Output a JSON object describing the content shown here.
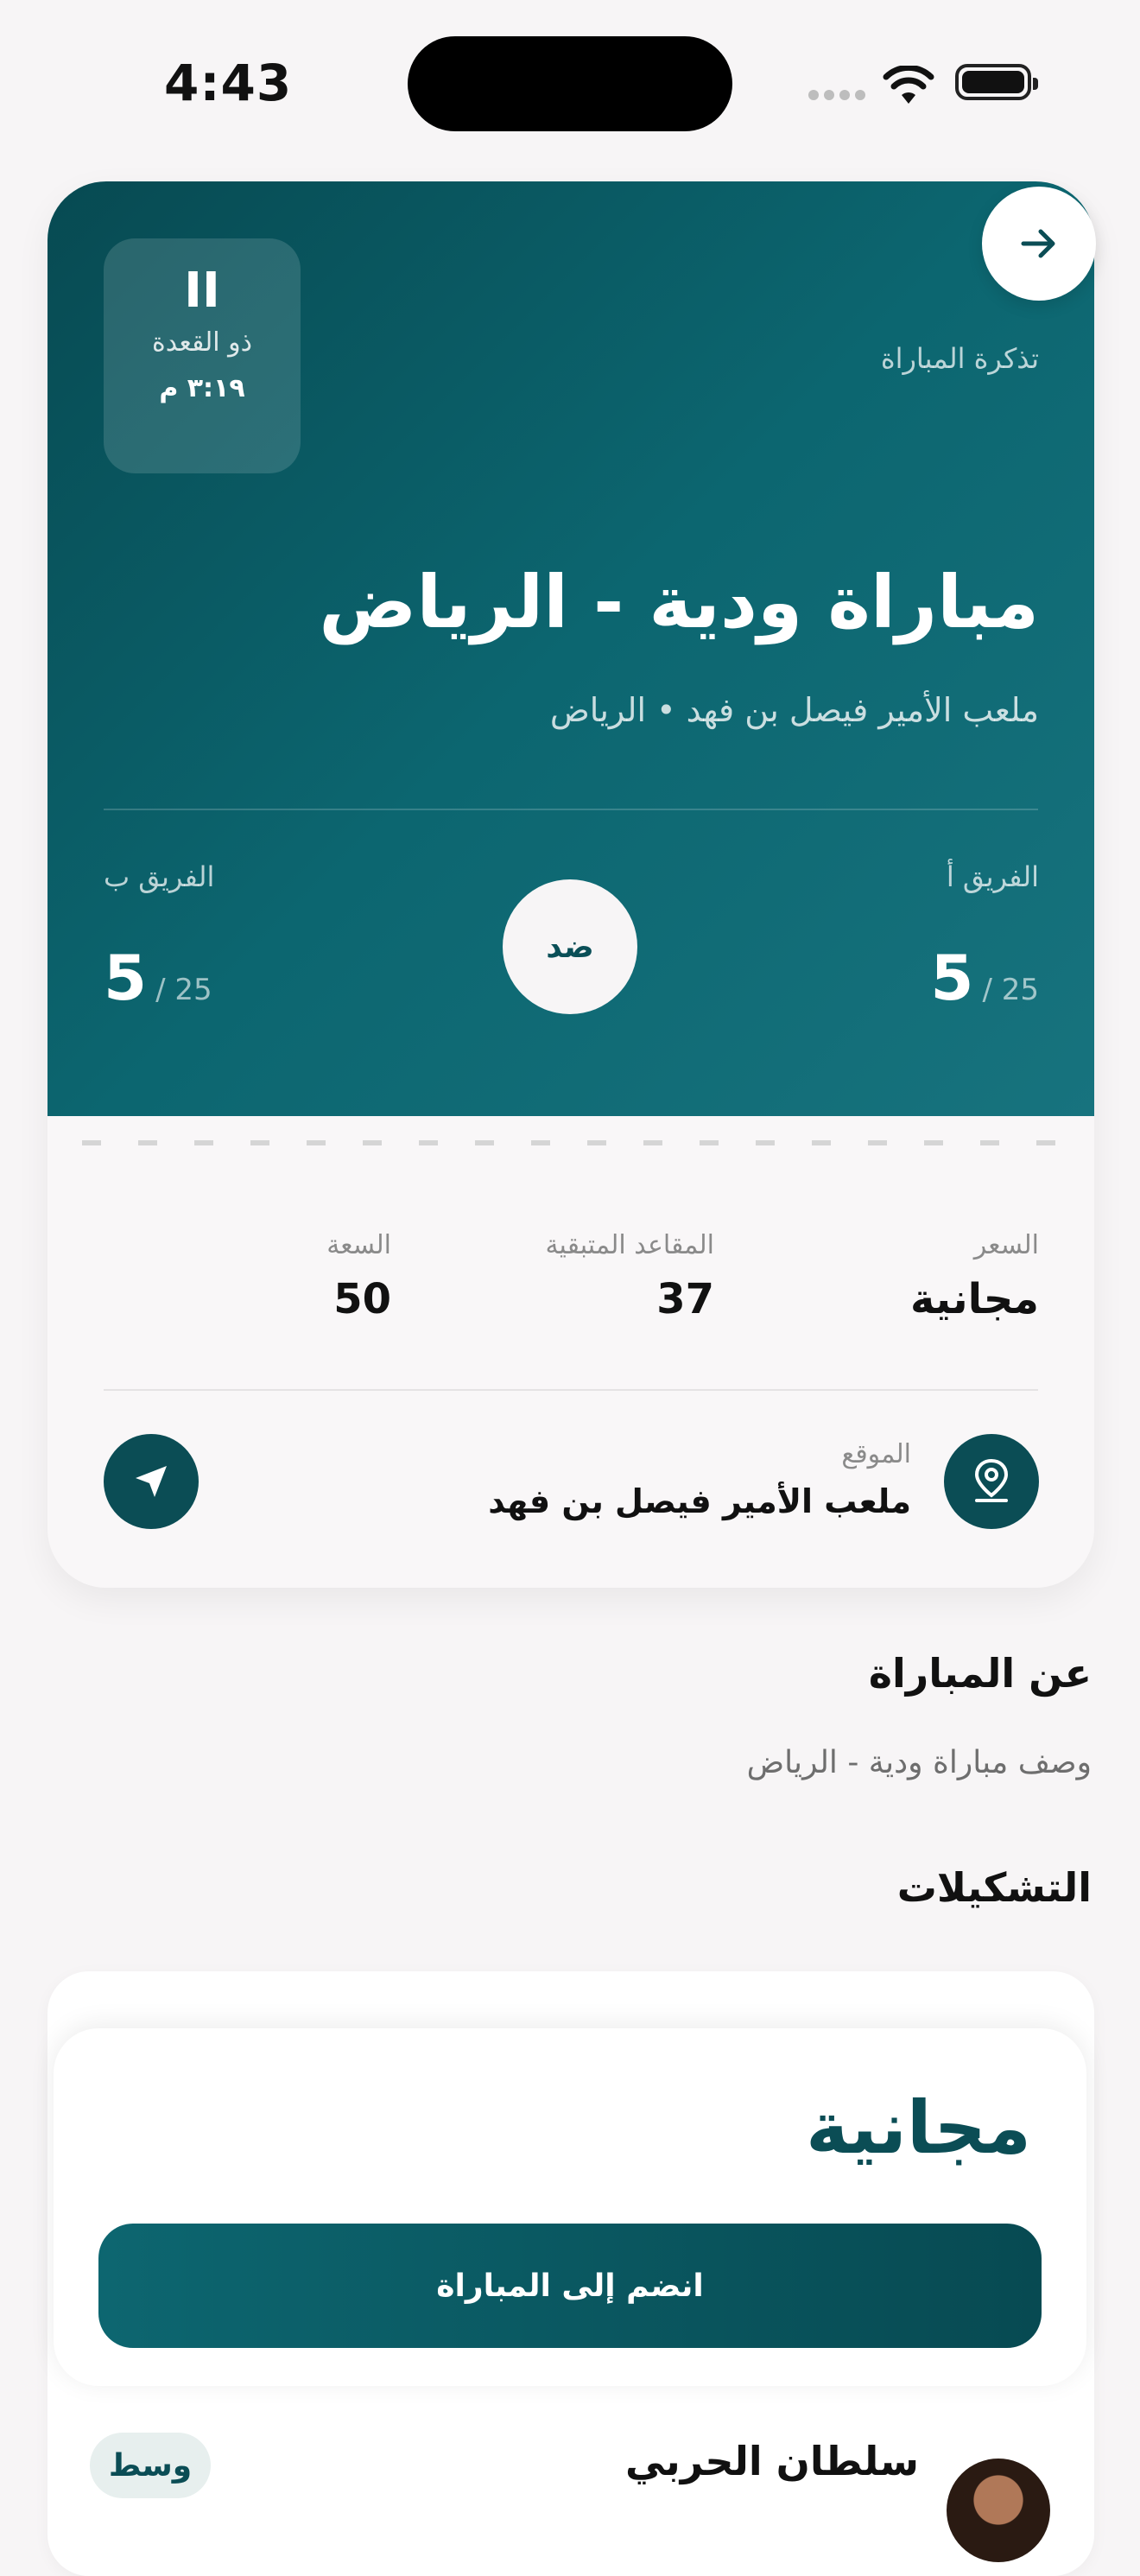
{
  "status_bar": {
    "time": "4:43"
  },
  "ticket": {
    "label": "تذكرة المباراة",
    "date": {
      "day": "II",
      "month": "ذو القعدة",
      "time": "٣:١٩ م"
    },
    "title": "مباراة ودية - الرياض",
    "subtitle": "ملعب الأمير فيصل بن فهد • الرياض",
    "team_a": {
      "label": "الفريق أ",
      "count": "5",
      "max": "/ 25"
    },
    "team_b": {
      "label": "الفريق ب",
      "count": "5",
      "max": "/ 25"
    },
    "vs_label": "ضد",
    "stats": {
      "price_label": "السعر",
      "price_value": "مجانية",
      "seats_label": "المقاعد المتبقية",
      "seats_value": "37",
      "capacity_label": "السعة",
      "capacity_value": "50"
    },
    "location": {
      "label": "الموقع",
      "value": "ملعب الأمير فيصل بن فهد"
    }
  },
  "about": {
    "title": "عن المباراة",
    "description": "وصف مباراة ودية - الرياض"
  },
  "lineups": {
    "title": "التشكيلات",
    "player": {
      "name": "سلطان الحربي",
      "position": "وسط"
    }
  },
  "bottom_sheet": {
    "price": "مجانية",
    "join_label": "انضم إلى المباراة"
  },
  "colors": {
    "primary": "#0B4D55",
    "background": "#F7F5F6"
  }
}
